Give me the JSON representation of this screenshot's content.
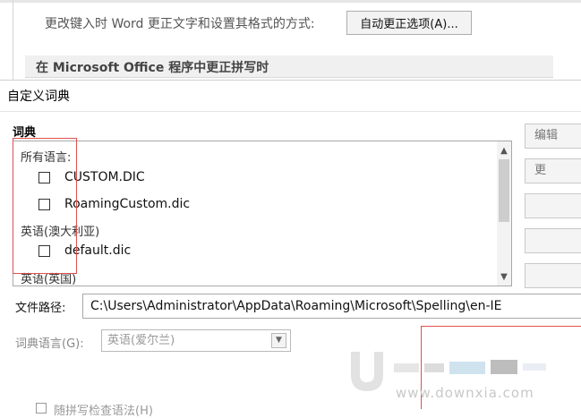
{
  "options": {
    "autocorrect_label": "更改键入时 Word 更正文字和设置其格式的方式:",
    "autocorrect_button": "自动更正选项(A)...",
    "section_title": "在 Microsoft Office 程序中更正拼写时"
  },
  "dialog": {
    "title": "自定义词典",
    "group_label": "词典",
    "lists": {
      "lang1": "所有语言:",
      "item1": "CUSTOM.DIC",
      "item2": "RoamingCustom.dic",
      "lang2": "英语(澳大利亚)",
      "item3": "default.dic",
      "lang3": "英语(英国)"
    },
    "side_buttons": [
      "编辑",
      "更",
      "",
      "",
      ""
    ],
    "file_path_label": "文件路径:",
    "file_path_value": "C:\\Users\\Administrator\\AppData\\Roaming\\Microsoft\\Spelling\\en-IE",
    "dict_lang_label": "词典语言(G):",
    "dict_lang_value": "英语(爱尔兰)"
  },
  "watermark": {
    "text": "www.downxia.com"
  },
  "bottom": {
    "hint": "随拼写检查语法(H)"
  },
  "colors": {
    "highlight": "#e05050",
    "border": "#a8a8a8"
  }
}
